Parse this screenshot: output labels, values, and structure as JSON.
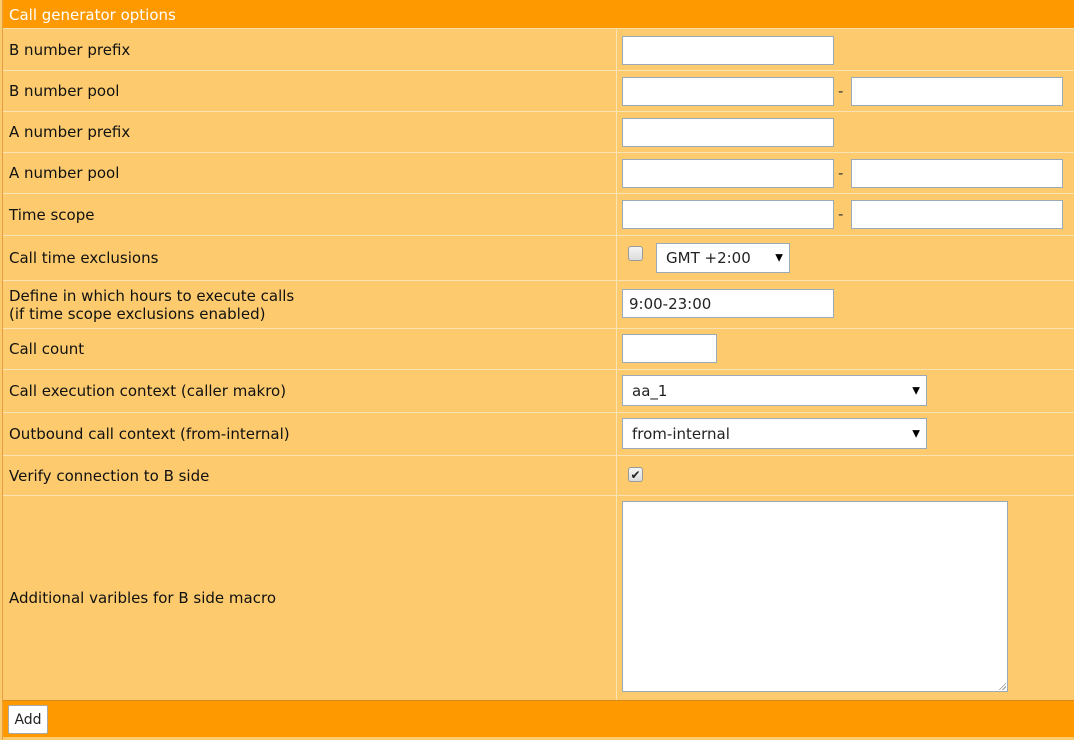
{
  "header": {
    "title": "Call generator options"
  },
  "rows": {
    "b_prefix": {
      "label": "B number prefix",
      "value": ""
    },
    "b_pool": {
      "label": "B number pool",
      "from": "",
      "to": "",
      "sep": "-"
    },
    "a_prefix": {
      "label": "A number prefix",
      "value": ""
    },
    "a_pool": {
      "label": "A number pool",
      "from": "",
      "to": "",
      "sep": "-"
    },
    "time_scope": {
      "label": "Time scope",
      "from": "",
      "to": "",
      "sep": "-"
    },
    "exclusions": {
      "label": "Call time exclusions",
      "checked": false,
      "timezone": "GMT +2:00"
    },
    "hours": {
      "label_line1": "Define in which hours to execute calls",
      "label_line2": "(if time scope exclusions enabled)",
      "value": "9:00-23:00"
    },
    "call_count": {
      "label": "Call count",
      "value": ""
    },
    "exec_context": {
      "label": "Call execution context (caller makro)",
      "selected": "aa_1"
    },
    "outbound_context": {
      "label": "Outbound call context (from-internal)",
      "selected": "from-internal"
    },
    "verify": {
      "label": "Verify connection to B side",
      "checked": true,
      "check_glyph": "✔"
    },
    "additional": {
      "label": "Additional varibles for B side macro",
      "value": ""
    }
  },
  "footer": {
    "add_label": "Add"
  },
  "icons": {
    "select_caret": "▼"
  },
  "colors": {
    "accent": "#ff9900",
    "panel": "#fdcb6e"
  }
}
